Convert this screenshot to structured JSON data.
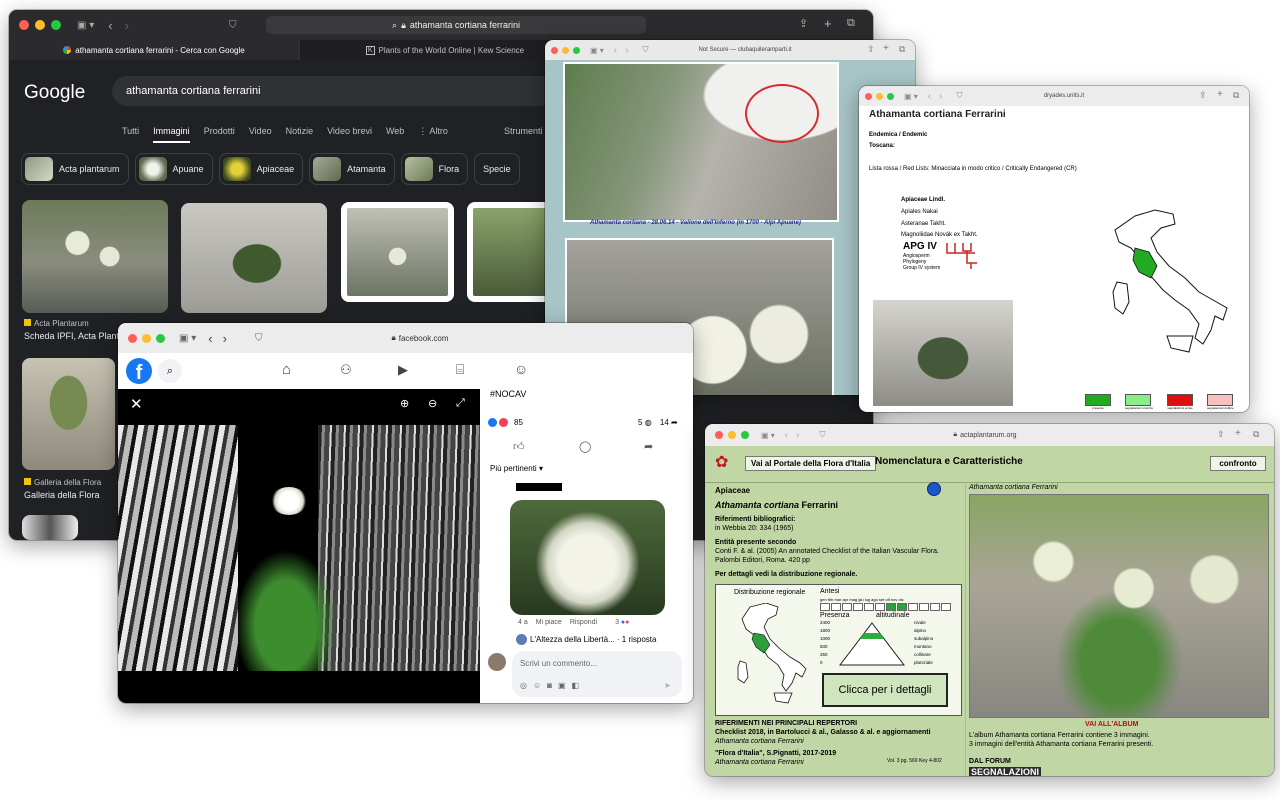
{
  "google": {
    "url": "athamanta cortiana ferrarini",
    "tab1": "athamanta cortiana ferrarini - Cerca con Google",
    "tab2": "Plants of the World Online | Kew Science",
    "logo": "Google",
    "query": "athamanta cortiana ferrarini",
    "nav": [
      "Tutti",
      "Immagini",
      "Prodotti",
      "Video",
      "Notizie",
      "Video brevi",
      "Web",
      "⋮ Altro"
    ],
    "tools": "Strumenti",
    "chips": [
      "Acta plantarum",
      "Apuane",
      "Apiaceae",
      "Atamanta",
      "Flora",
      "Specie"
    ],
    "result1_source": "Acta Plantarum",
    "result1_title": "Scheda IPFI, Acta Plant",
    "result2_source": "Galleria della Flora",
    "result2_title": "Galleria della Flora"
  },
  "facebook": {
    "url": "facebook.com",
    "hashtag": "#NOCAV",
    "reactions": "85",
    "comments": "5",
    "shares": "14",
    "sort": "Più pertinenti",
    "comment_time": "4 a",
    "like": "Mi piace",
    "reply": "Rispondi",
    "comment_react": "3",
    "thread": "L'Altezza della Libertà... · 1 risposta",
    "write": "Scrivi un commento..."
  },
  "club": {
    "url": "Not Secure — clubaquileramparti.it",
    "caption": "Athamanta cortiana - 28.06.14 - Vallone dell'Inferno (m 1700 - Alpi Apuane)"
  },
  "dryades": {
    "url": "dryades.units.it",
    "title": "Athamanta cortiana Ferrarini",
    "endemic": "Endemica / Endemic",
    "region": "Toscana:",
    "redlist": "Lista rossa / Red Lists: Minacciata in modo critico / Critically Endangered (CR)",
    "tax": [
      "Apiaceae Lindl.",
      "Apiales Nakai",
      "Asteranae Takht.",
      "Magnoliidae Novák ex Takht."
    ],
    "apg": "APG IV",
    "apg_sub": [
      "Angiosperm",
      "Phylogeny",
      "Group IV system"
    ],
    "legend": [
      "presente",
      "segnalazioni storiche",
      "segnalazioni errate",
      "segnalazioni dubbie"
    ]
  },
  "acta": {
    "url": "actaplantarum.org",
    "portal_btn": "Vai al Portale della Flora d'Italia",
    "header": "Nomenclatura e Caratteristiche",
    "confronto": "confronto",
    "family": "Apiaceae",
    "species": "Athamanta cortiana",
    "author": "Ferrarini",
    "refs_label": "Riferimenti bibliografici:",
    "refs": "in Webbia 20: 334 (1965)",
    "entity_label": "Entità presente secondo",
    "entity1": "Conti F. & al. (2005) An annotated Checklist of the Italian Vascular Flora.",
    "entity2": "Palombi Editori, Roma. 420 pp",
    "details": "Per dettagli vedi la distribuzione regionale.",
    "dist_label": "Distribuzione regionale",
    "antesi": "Antesi",
    "presenza": "Presenza",
    "altitudinale": "altitudinale",
    "months": "gen feb mar apr mag giu lug ago set ott nov dic",
    "alt_levels": [
      "2400",
      "1800",
      "1000",
      "500",
      "250",
      "0"
    ],
    "alt_labels": [
      "nivale",
      "alpino",
      "subalpino",
      "montano",
      "collinare",
      "planiziale"
    ],
    "click": "Clicca per i dettagli",
    "rif_header": "RIFERIMENTI NEI PRINCIPALI REPERTORI",
    "checklist": "Checklist 2018, in Bartolucci & al., Galasso & al. e aggiornamenti",
    "checklist_sp": "Athamanta cortiana Ferrarini",
    "flora": "\"Flora d'Italia\", S.Pignatti, 2017-2019",
    "flora_sp": "Athamanta cortiana Ferrarini",
    "flora_ref": "Vol. 3 pg. 569 Key 4-802",
    "photo_caption": "Athamanta cortiana Ferrarini",
    "album_link": "VAI ALL'ALBUM",
    "album1": "L'album Athamanta cortiana Ferrarini contiene 3 immagini.",
    "album2": "3 immagini dell'entità  Athamanta cortiana Ferrarini presenti.",
    "forum": "DAL FORUM",
    "segnalazioni": "SEGNALAZIONI"
  }
}
